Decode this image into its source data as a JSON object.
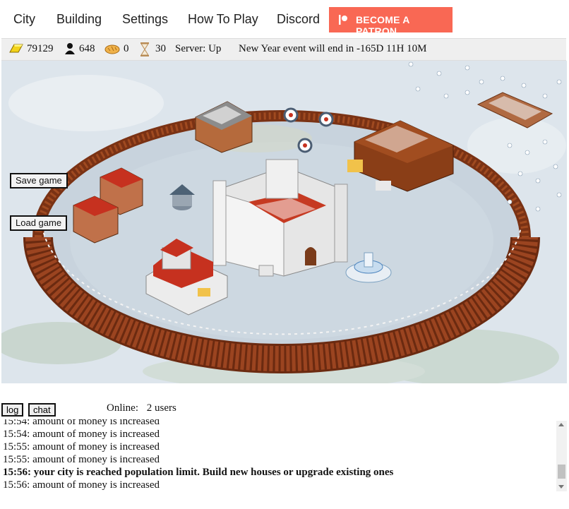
{
  "nav": {
    "items": [
      "City",
      "Building",
      "Settings",
      "How To Play",
      "Discord"
    ],
    "patron_label": "BECOME A PATRON",
    "patron_color": "#f96854"
  },
  "status": {
    "gold": "79129",
    "population": "648",
    "food": "0",
    "time": "30",
    "server": "Server: Up",
    "event": "New Year event will end in -165D 11H 10M",
    "icons": [
      "gold-bar-icon",
      "person-icon",
      "bread-icon",
      "hourglass-icon"
    ]
  },
  "map": {
    "save_label": "Save game",
    "load_label": "Load game"
  },
  "bottom": {
    "log_tab": "log",
    "chat_tab": "chat",
    "online_label": "Online:",
    "online_count": "2 users",
    "log_lines": [
      {
        "time": "15:54:",
        "text": "amount of money is increased",
        "bold": false
      },
      {
        "time": "15:54:",
        "text": "amount of money is increased",
        "bold": false
      },
      {
        "time": "15:55:",
        "text": "amount of money is increased",
        "bold": false
      },
      {
        "time": "15:55:",
        "text": "amount of money is increased",
        "bold": false
      },
      {
        "time": "15:56:",
        "text": "your city is reached population limit. Build new houses or upgrade existing ones",
        "bold": true
      },
      {
        "time": "15:56:",
        "text": "amount of money is increased",
        "bold": false
      }
    ]
  }
}
